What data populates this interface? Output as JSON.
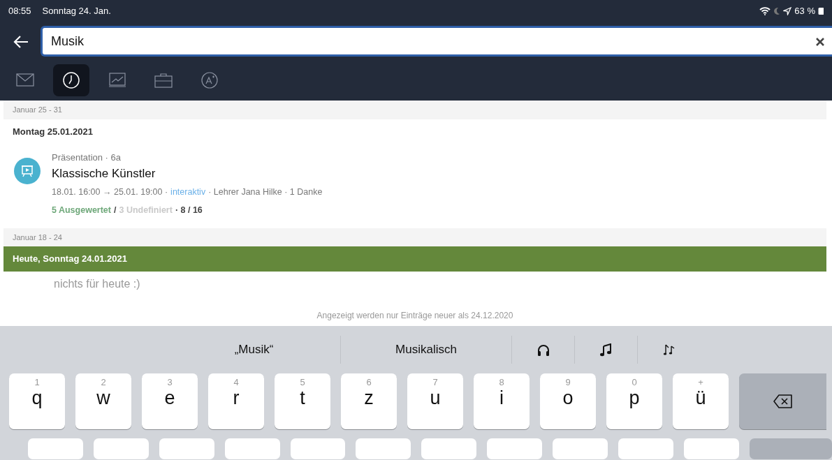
{
  "status_bar": {
    "time": "08:55",
    "date": "Sonntag 24. Jan.",
    "battery": "63 %"
  },
  "search": {
    "value": "Musik"
  },
  "tabs": [
    {
      "kind": "mail",
      "selected": false
    },
    {
      "kind": "clock",
      "selected": true
    },
    {
      "kind": "board",
      "selected": false
    },
    {
      "kind": "briefcase",
      "selected": false
    },
    {
      "kind": "grade",
      "selected": false
    }
  ],
  "sections": [
    {
      "range": "Januar 25 - 31",
      "days": [
        {
          "title": "Montag 25.01.2021",
          "today": false,
          "entries": [
            {
              "category": "Präsentation · 6a",
              "title": "Klassische Künstler",
              "meta": [
                {
                  "text": "18.01. 16:00 → 25.01. 19:00 ·",
                  "kind": "plain"
                },
                {
                  "text": "interaktiv",
                  "kind": "link"
                },
                {
                  "text": "· Lehrer Jana Hilke · 1 Danke",
                  "kind": "plain"
                }
              ],
              "stats": [
                {
                  "text": "5 Ausgewertet",
                  "kind": "good"
                },
                {
                  "text": "/",
                  "kind": "strong"
                },
                {
                  "text": "3 Undefiniert",
                  "kind": "muted"
                },
                {
                  "text": "· 8 / 16",
                  "kind": "strong"
                }
              ]
            }
          ]
        }
      ]
    },
    {
      "range": "Januar 18 - 24",
      "days": [
        {
          "title": "Heute, Sonntag 24.01.2021",
          "today": true,
          "empty": "nichts für heute :)"
        }
      ]
    }
  ],
  "footer_note": "Angezeigt werden nur Einträge neuer als 24.12.2020",
  "keyboard": {
    "suggestions": [
      {
        "kind": "text",
        "label": "„Musik“"
      },
      {
        "kind": "text",
        "label": "Musikalisch"
      },
      {
        "kind": "headphones"
      },
      {
        "kind": "note"
      },
      {
        "kind": "notes"
      }
    ],
    "keys": [
      {
        "hint": "1",
        "letter": "q"
      },
      {
        "hint": "2",
        "letter": "w"
      },
      {
        "hint": "3",
        "letter": "e"
      },
      {
        "hint": "4",
        "letter": "r"
      },
      {
        "hint": "5",
        "letter": "t"
      },
      {
        "hint": "6",
        "letter": "z"
      },
      {
        "hint": "7",
        "letter": "u"
      },
      {
        "hint": "8",
        "letter": "i"
      },
      {
        "hint": "9",
        "letter": "o"
      },
      {
        "hint": "0",
        "letter": "p"
      },
      {
        "hint": "+",
        "letter": "ü"
      }
    ]
  }
}
